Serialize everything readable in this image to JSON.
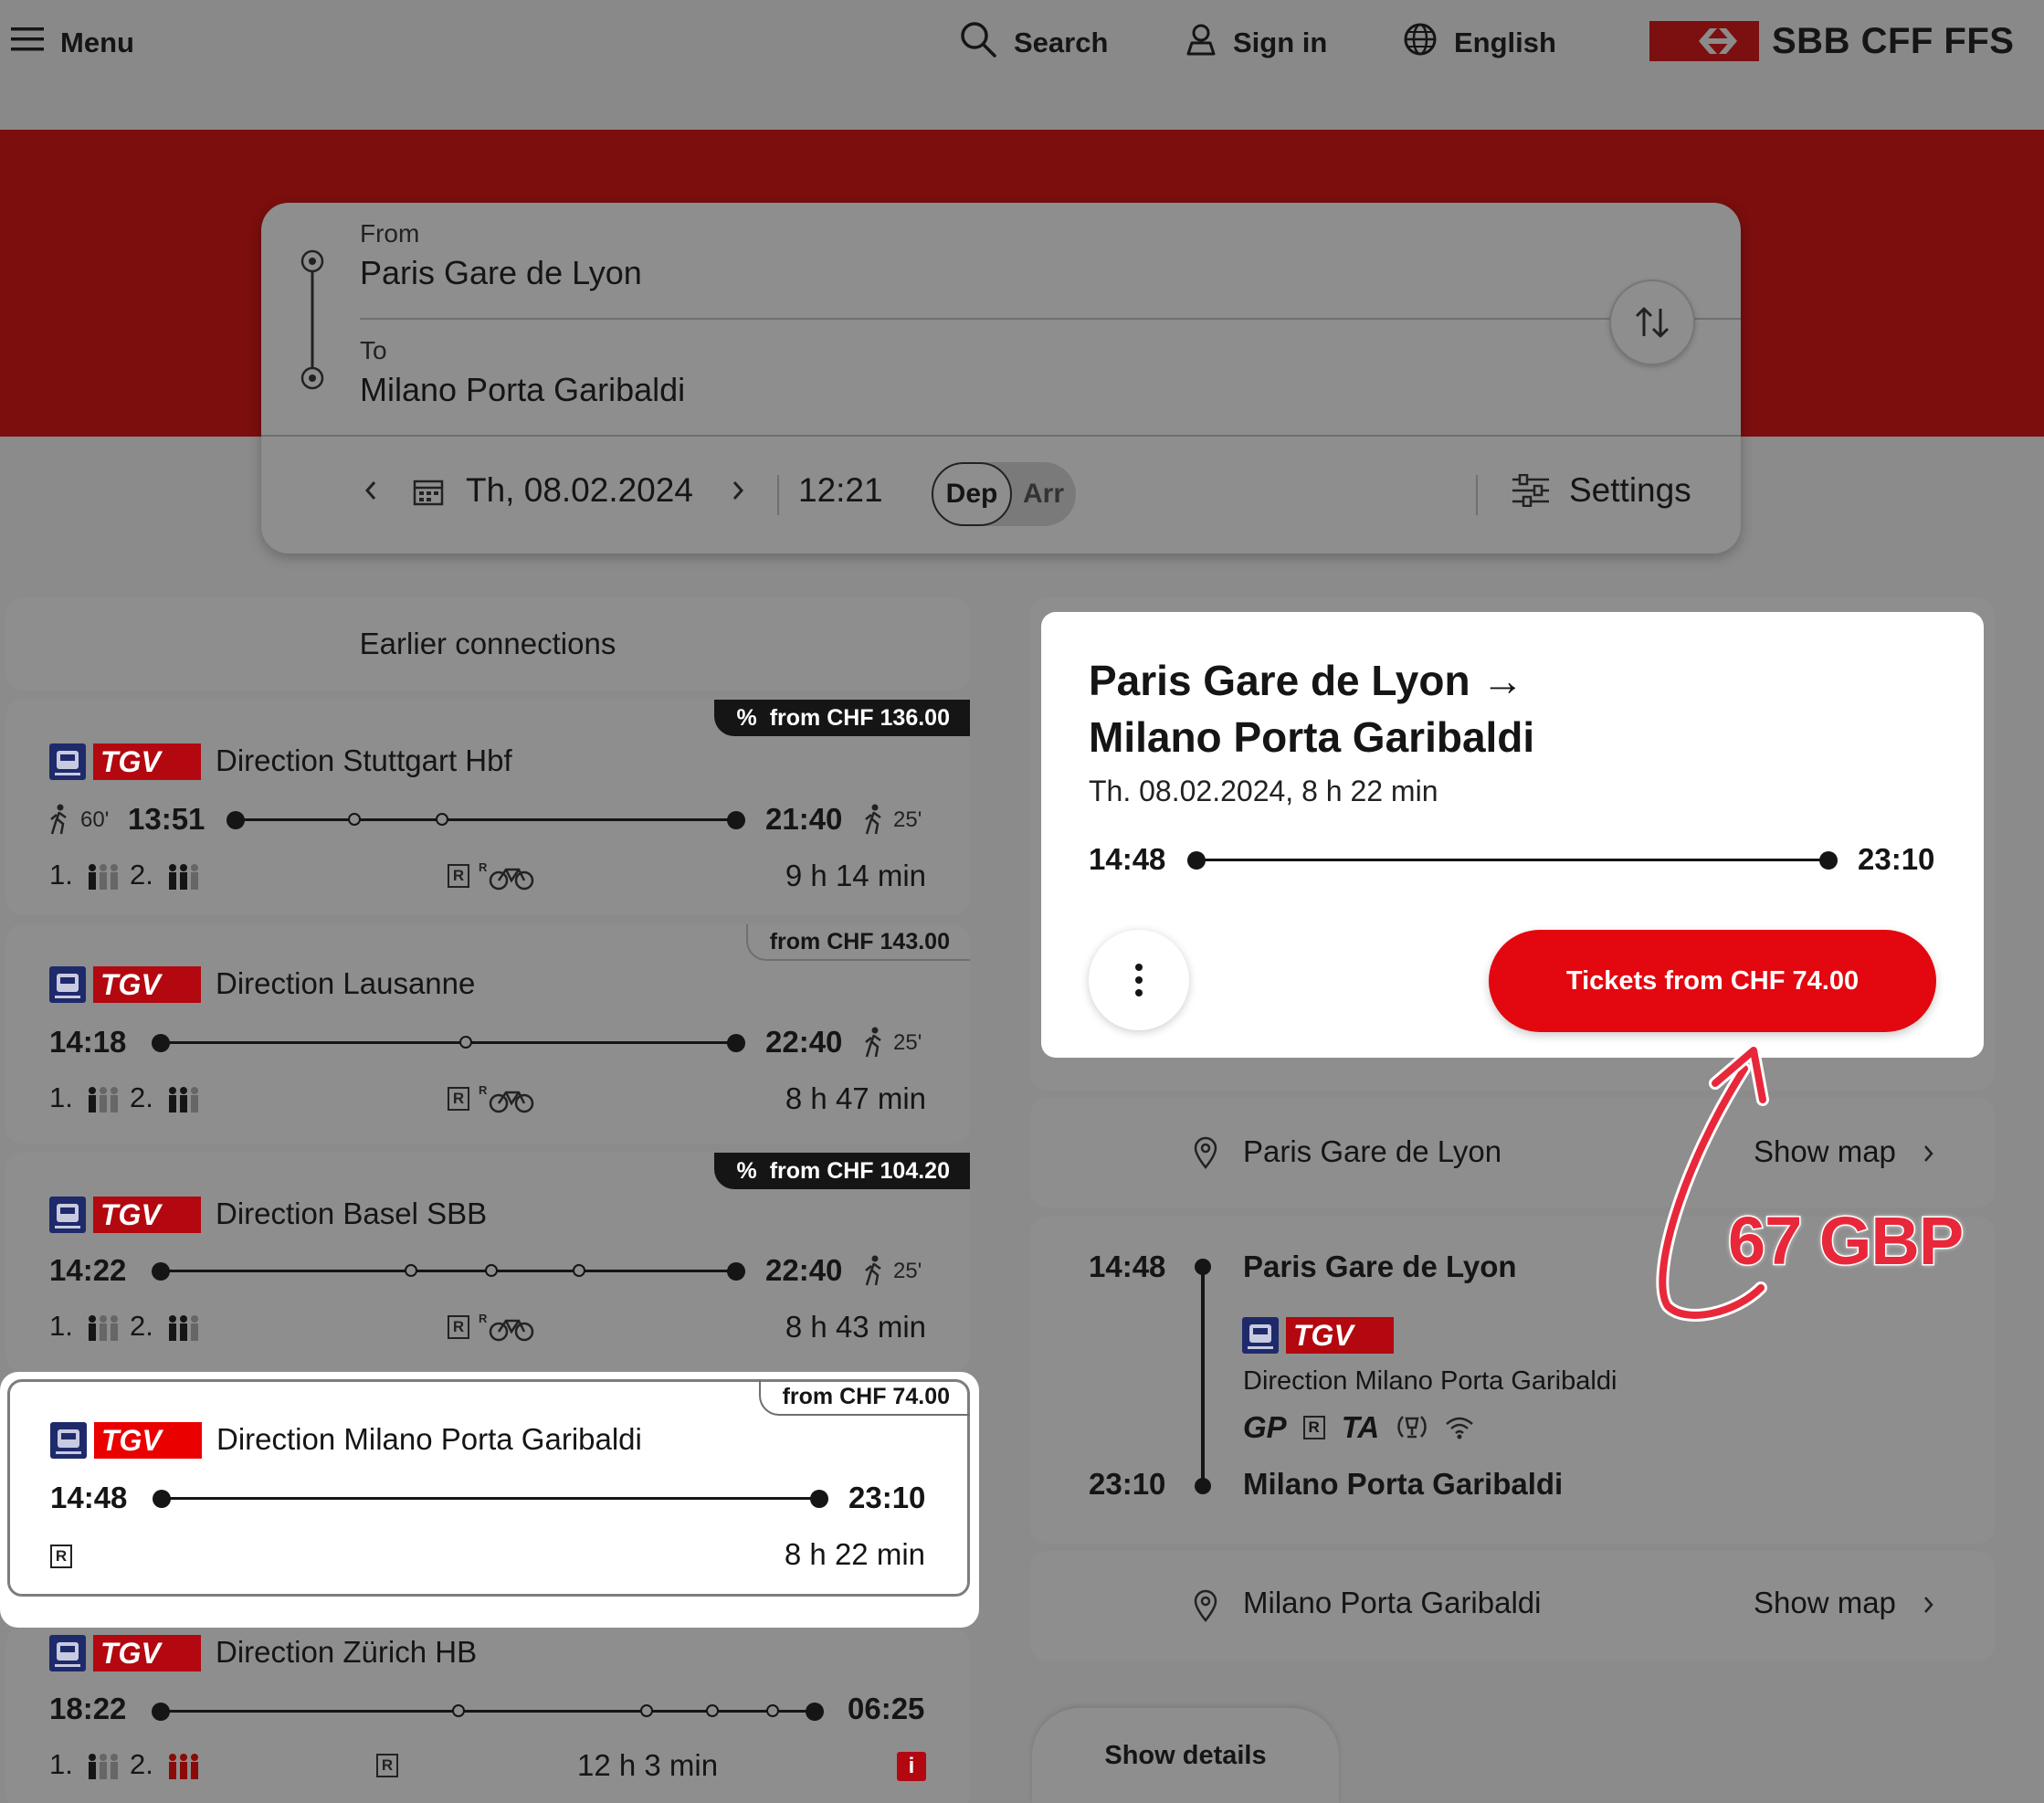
{
  "header": {
    "menu_label": "Menu",
    "search_label": "Search",
    "signin_label": "Sign in",
    "language_label": "English",
    "brand": "SBB CFF FFS"
  },
  "search": {
    "from_label": "From",
    "from_value": "Paris Gare de Lyon",
    "to_label": "To",
    "to_value": "Milano Porta Garibaldi",
    "date": "Th, 08.02.2024",
    "time": "12:21",
    "dep_label": "Dep",
    "arr_label": "Arr",
    "settings_label": "Settings"
  },
  "earlier_label": "Earlier connections",
  "connections": [
    {
      "price": "from CHF  136.00",
      "price_percent": "%",
      "product": "TGV",
      "direction": "Direction Stuttgart Hbf",
      "walk_before": "60'",
      "dep": "13:51",
      "arr": "21:40",
      "walk_after": "25'",
      "class1": "1.",
      "class2": "2.",
      "duration": "9 h 14 min"
    },
    {
      "price": "from CHF  143.00",
      "product": "TGV",
      "direction": "Direction Lausanne",
      "dep": "14:18",
      "arr": "22:40",
      "walk_after": "25'",
      "class1": "1.",
      "class2": "2.",
      "duration": "8 h 47 min"
    },
    {
      "price": "from CHF  104.20",
      "price_percent": "%",
      "product": "TGV",
      "direction": "Direction Basel SBB",
      "dep": "14:22",
      "arr": "22:40",
      "walk_after": "25'",
      "class1": "1.",
      "class2": "2.",
      "duration": "8 h 43 min"
    },
    {
      "price": "from CHF  74.00",
      "product": "TGV",
      "direction": "Direction Milano Porta Garibaldi",
      "dep": "14:48",
      "arr": "23:10",
      "duration": "8 h 22 min"
    },
    {
      "product": "TGV",
      "direction": "Direction Zürich HB",
      "dep": "18:22",
      "arr": "06:25",
      "class1": "1.",
      "class2": "2.",
      "duration": "12 h 3 min",
      "info_icon": "i"
    }
  ],
  "detail": {
    "title_line1": "Paris Gare de Lyon →",
    "title_line2": "Milano Porta Garibaldi",
    "subtitle": "Th. 08.02.2024, 8 h 22 min",
    "dep": "14:48",
    "arr": "23:10",
    "ticket_button": "Tickets from CHF 74.00",
    "origin_station": "Paris Gare de Lyon",
    "show_map": "Show map",
    "leg_dep_time": "14:48",
    "leg_dep_station": "Paris Gare de Lyon",
    "leg_product": "TGV",
    "leg_direction": "Direction Milano Porta Garibaldi",
    "leg_attrs": [
      "GP",
      "R",
      "TA"
    ],
    "leg_arr_time": "23:10",
    "leg_arr_station": "Milano Porta Garibaldi",
    "dest_station": "Milano Porta Garibaldi",
    "show_map_2": "Show map",
    "show_details": "Show details"
  },
  "annotation": "67 GBP",
  "colors": {
    "sbb_red": "#eb0000",
    "accent_button": "#e3070f",
    "annotation_red": "#e8283a",
    "dimmed_overlay": "#8b8b8b",
    "train_icon_blue": "#1f2a6b"
  }
}
